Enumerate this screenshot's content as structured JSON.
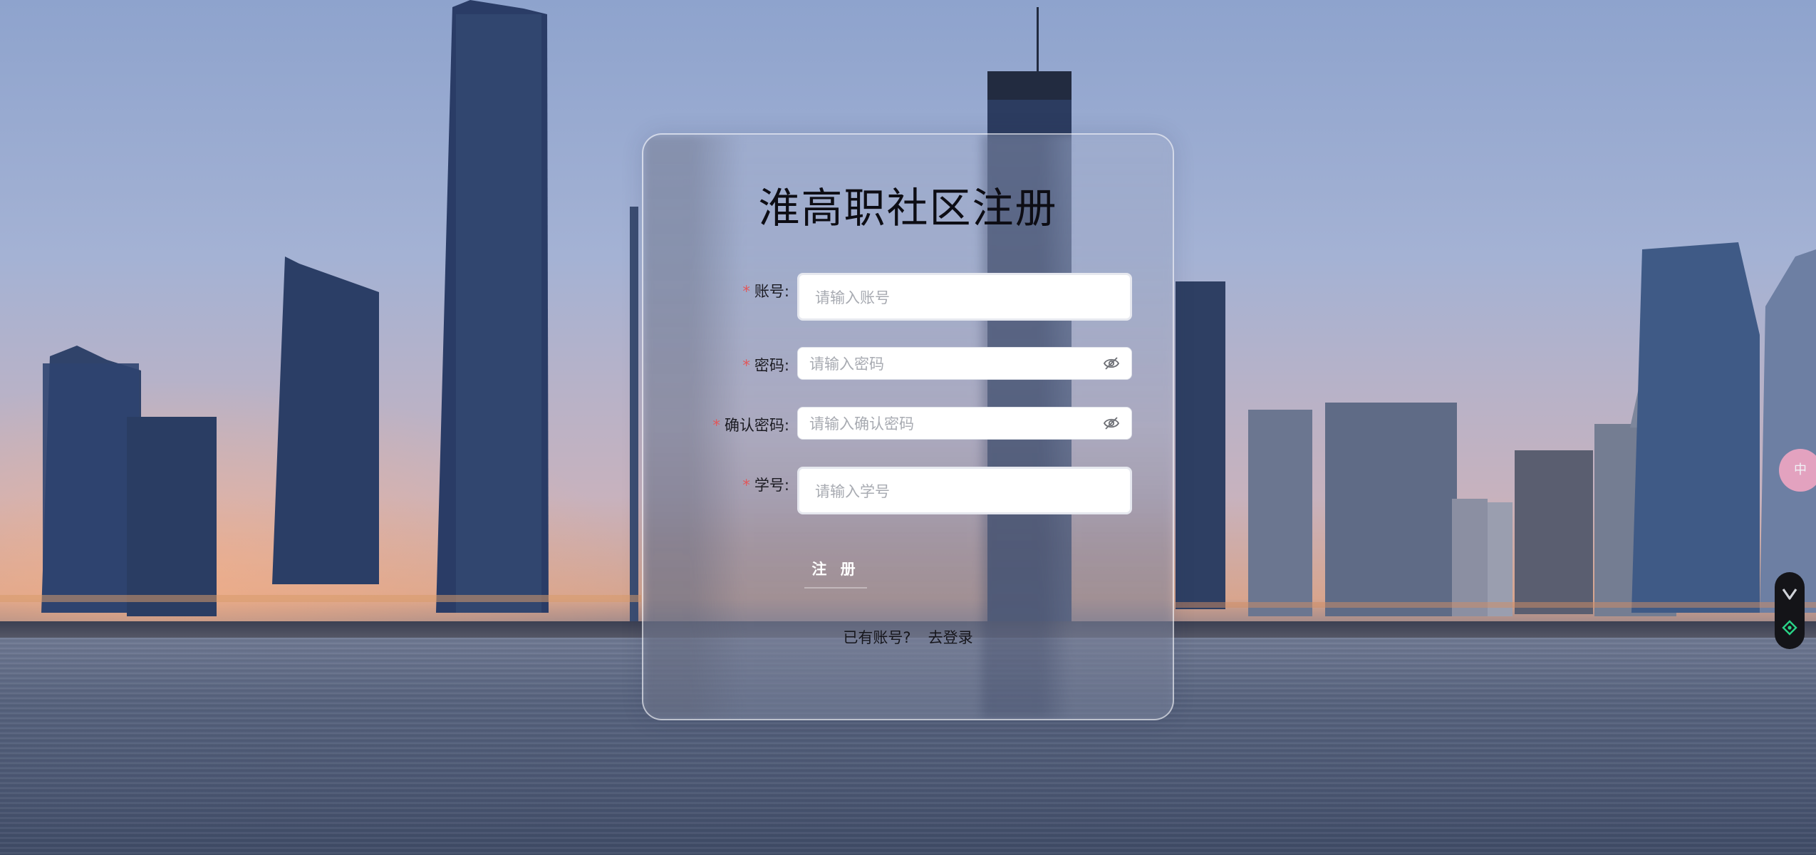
{
  "form": {
    "title": "淮高职社区注册",
    "fields": [
      {
        "label": "账号:",
        "required_mark": "*",
        "placeholder": "请输入账号"
      },
      {
        "label": "密码:",
        "required_mark": "*",
        "placeholder": "请输入密码",
        "icon": "eye-off-icon"
      },
      {
        "label": "确认密码:",
        "required_mark": "*",
        "placeholder": "请输入确认密码",
        "icon": "eye-off-icon"
      },
      {
        "label": "学号:",
        "required_mark": "*",
        "placeholder": "请输入学号"
      }
    ],
    "submit_label": "注 册",
    "have_account_text": "已有账号?",
    "login_link_label": "去登录"
  },
  "widgets": {
    "badge_text": "中",
    "dock_icons": [
      "chevron-down-icon",
      "locate-icon"
    ]
  },
  "colors": {
    "required": "#e2575a",
    "dock_bg": "#141418",
    "dock_icon_top": "#cfd2d8",
    "dock_icon_bottom": "#29d487",
    "badge": "#f0a6c3"
  }
}
